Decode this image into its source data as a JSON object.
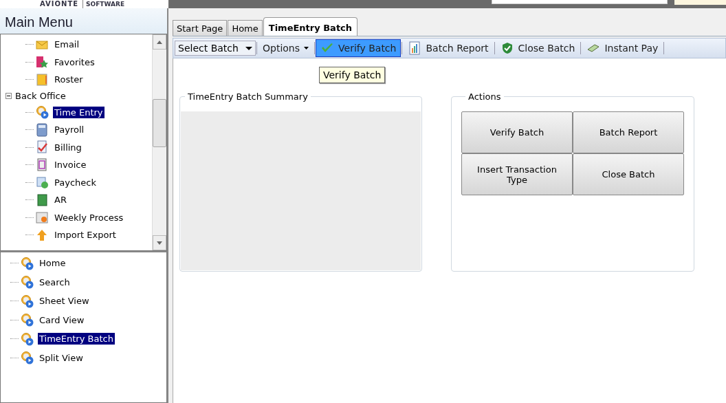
{
  "logo": {
    "name": "AVIONTE",
    "tagline": "SOFTWARE"
  },
  "main_menu": {
    "title": "Main Menu",
    "items": [
      {
        "label": "Email",
        "selected": false
      },
      {
        "label": "Favorites",
        "selected": false
      },
      {
        "label": "Roster",
        "selected": false
      },
      {
        "label": "Back Office",
        "expanded": true,
        "selected": false,
        "children": [
          {
            "label": "Time Entry",
            "selected": true
          },
          {
            "label": "Payroll",
            "selected": false
          },
          {
            "label": "Billing",
            "selected": false
          },
          {
            "label": "Invoice",
            "selected": false
          },
          {
            "label": "Paycheck",
            "selected": false
          },
          {
            "label": "AR",
            "selected": false
          },
          {
            "label": "Weekly Process",
            "selected": false
          },
          {
            "label": "Import Export",
            "selected": false
          }
        ]
      }
    ]
  },
  "views": [
    {
      "label": "Home",
      "selected": false
    },
    {
      "label": "Search",
      "selected": false
    },
    {
      "label": "Sheet View",
      "selected": false
    },
    {
      "label": "Card View",
      "selected": false
    },
    {
      "label": "TimeEntry Batch",
      "selected": true
    },
    {
      "label": "Split View",
      "selected": false
    }
  ],
  "tabs": [
    {
      "label": "Start Page",
      "selected": false
    },
    {
      "label": "Home",
      "selected": false
    },
    {
      "label": "TimeEntry Batch",
      "selected": true
    }
  ],
  "toolbar": [
    {
      "kind": "dropdown",
      "label": "Select Batch"
    },
    {
      "kind": "menu",
      "label": "Options",
      "selected": false
    },
    {
      "kind": "button",
      "label": "Verify Batch",
      "selected": true
    },
    {
      "kind": "button",
      "label": "Batch Report",
      "selected": false
    },
    {
      "kind": "button",
      "label": "Close Batch",
      "selected": false
    },
    {
      "kind": "button",
      "label": "Instant Pay",
      "selected": false
    }
  ],
  "tooltip": "Verify Batch",
  "summary": {
    "title": "TimeEntry Batch Summary"
  },
  "actions": {
    "title": "Actions",
    "buttons": [
      "Verify Batch",
      "Batch Report",
      "Insert Transaction Type",
      "Close Batch"
    ]
  }
}
